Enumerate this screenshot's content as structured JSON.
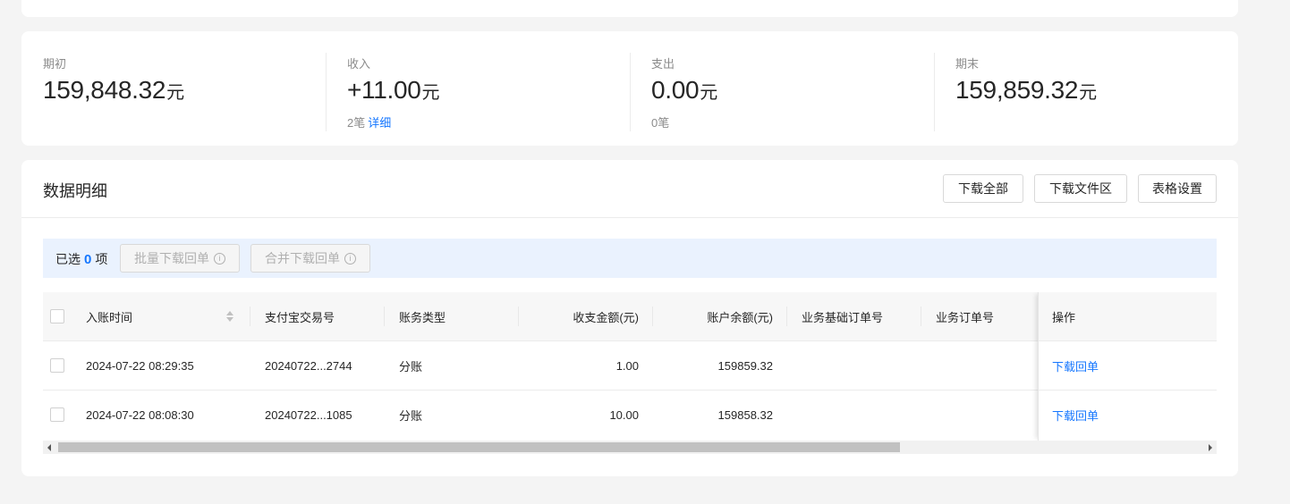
{
  "summary": {
    "opening": {
      "label": "期初",
      "value": "159,848.32",
      "unit": "元"
    },
    "income": {
      "label": "收入",
      "value": "+11.00",
      "unit": "元",
      "count": "2笔",
      "link": "详细"
    },
    "expense": {
      "label": "支出",
      "value": "0.00",
      "unit": "元",
      "count": "0笔"
    },
    "closing": {
      "label": "期末",
      "value": "159,859.32",
      "unit": "元"
    }
  },
  "detail": {
    "title": "数据明细",
    "buttons": {
      "download_all": "下载全部",
      "download_area": "下载文件区",
      "table_settings": "表格设置"
    },
    "selection": {
      "prefix": "已选",
      "count": "0",
      "suffix": "项",
      "batch_download": "批量下载回单",
      "merge_download": "合并下载回单"
    }
  },
  "table": {
    "columns": [
      "入账时间",
      "支付宝交易号",
      "账务类型",
      "收支金额(元)",
      "账户余额(元)",
      "业务基础订单号",
      "业务订单号",
      "操作"
    ],
    "rows": [
      {
        "time": "2024-07-22 08:29:35",
        "trade_no": "20240722...2744",
        "type": "分账",
        "amount": "1.00",
        "balance": "159859.32",
        "base_order": "",
        "order": "",
        "action": "下载回单"
      },
      {
        "time": "2024-07-22 08:08:30",
        "trade_no": "20240722...1085",
        "type": "分账",
        "amount": "10.00",
        "balance": "159858.32",
        "base_order": "",
        "order": "",
        "action": "下载回单"
      }
    ]
  },
  "colors": {
    "accent": "#1677ff",
    "select_bar": "#eaf2fe",
    "background": "#f4f4f4"
  }
}
